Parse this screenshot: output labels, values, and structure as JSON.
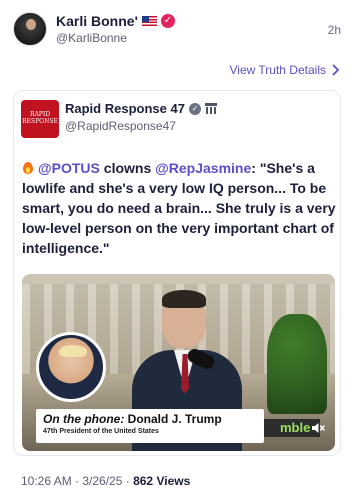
{
  "header": {
    "display_name": "Karli Bonne'",
    "handle": "@KarliBonne",
    "timestamp": "2h",
    "flag_icon": "us-flag-icon",
    "verified_icon": "verified-badge-icon"
  },
  "view_details": {
    "label": "View Truth Details",
    "icon": "chevron-right-icon"
  },
  "card": {
    "logo_text": "RAPID RESPONSE",
    "name": "Rapid Response 47",
    "handle": "@RapidResponse47",
    "quote": {
      "icon": "fire-icon",
      "mention1": "@POTUS",
      "text1": " clowns ",
      "mention2": "@RepJasmine",
      "text2": ": \"She's a lowlife and she's a very low IQ person... To be smart, you do need a brain... She truly is a very low-level person on the very important chart of intelligence.\""
    },
    "video": {
      "lower_third_label": "On the phone:",
      "lower_third_name": "Donald J. Trump",
      "lower_third_subtitle": "47th President of the United States",
      "brand_text": "mble",
      "speaker_icon": "speaker-muted-icon"
    }
  },
  "footer": {
    "datetime": "10:26 AM · 3/26/25 · ",
    "views_count": "862",
    "views_label": " Views"
  },
  "colors": {
    "accent": "#5b4fc9",
    "badge_pink": "#e0245e",
    "logo_red": "#c1121f"
  }
}
